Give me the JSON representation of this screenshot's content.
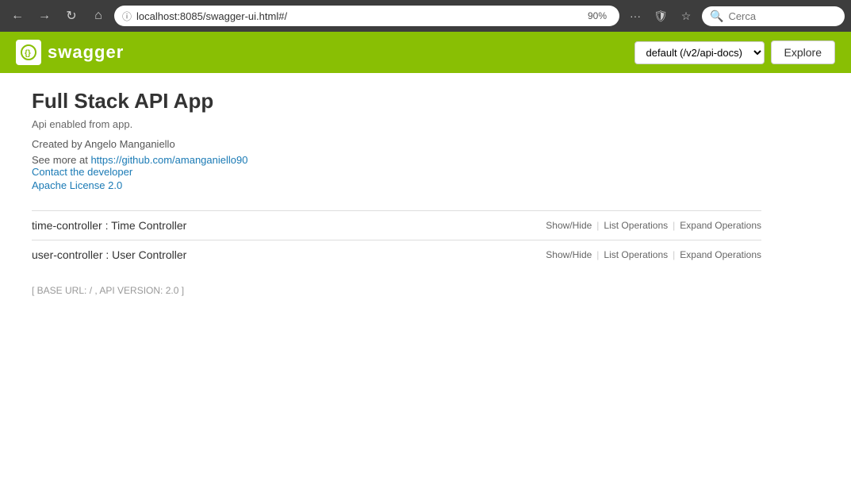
{
  "browser": {
    "url": "localhost:8085/swagger-ui.html#/",
    "zoom": "90%",
    "search_placeholder": "Cerca",
    "nav": {
      "back_label": "←",
      "forward_label": "→",
      "refresh_label": "↻",
      "home_label": "⌂"
    },
    "actions": {
      "more_label": "···",
      "shield_label": "🛡",
      "star_label": "☆"
    }
  },
  "swagger": {
    "logo_icon": "({})",
    "logo_text": "swagger",
    "api_selector_value": "default (/v2/api-docs)",
    "explore_label": "Explore"
  },
  "api": {
    "title": "Full Stack API App",
    "description": "Api enabled from app.",
    "meta": "Created by Angelo Manganiello",
    "github_url": "https://github.com/amanganiello90",
    "github_label": "https://github.com/amanganiello90",
    "see_more_prefix": "See more at ",
    "contact_label": "Contact the developer",
    "contact_url": "#",
    "license_label": "Apache License 2.0",
    "license_url": "#"
  },
  "controllers": [
    {
      "id": "time-controller",
      "name": "time-controller : Time Controller",
      "show_hide_label": "Show/Hide",
      "list_ops_label": "List Operations",
      "expand_ops_label": "Expand Operations"
    },
    {
      "id": "user-controller",
      "name": "user-controller : User Controller",
      "show_hide_label": "Show/Hide",
      "list_ops_label": "List Operations",
      "expand_ops_label": "Expand Operations"
    }
  ],
  "footer": {
    "base_url": "[ BASE URL: / , API VERSION: 2.0 ]"
  }
}
